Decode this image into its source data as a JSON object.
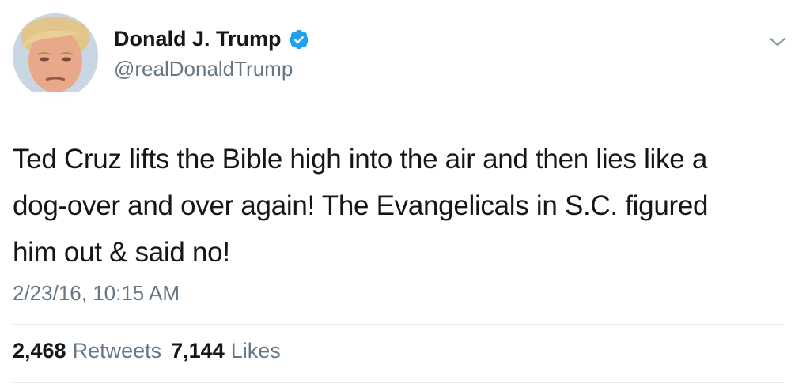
{
  "user": {
    "display_name": "Donald J. Trump",
    "handle": "@realDonaldTrump",
    "verified": true,
    "avatar_icon": "profile-photo"
  },
  "tweet": {
    "lines": [
      "Ted Cruz lifts the Bible high into the air and then lies like a",
      "dog-over and over again! The Evangelicals in S.C. figured",
      "him out & said no!"
    ],
    "timestamp": "2/23/16, 10:15 AM"
  },
  "stats": {
    "retweets_count": "2,468",
    "retweets_label": "Retweets",
    "likes_count": "7,144",
    "likes_label": "Likes"
  },
  "colors": {
    "text": "#14171a",
    "secondary": "#657786",
    "verified_blue": "#1da1f2",
    "divider": "#e1e8ed"
  },
  "icons": {
    "verified": "verified-badge-icon",
    "menu": "chevron-down-icon"
  }
}
